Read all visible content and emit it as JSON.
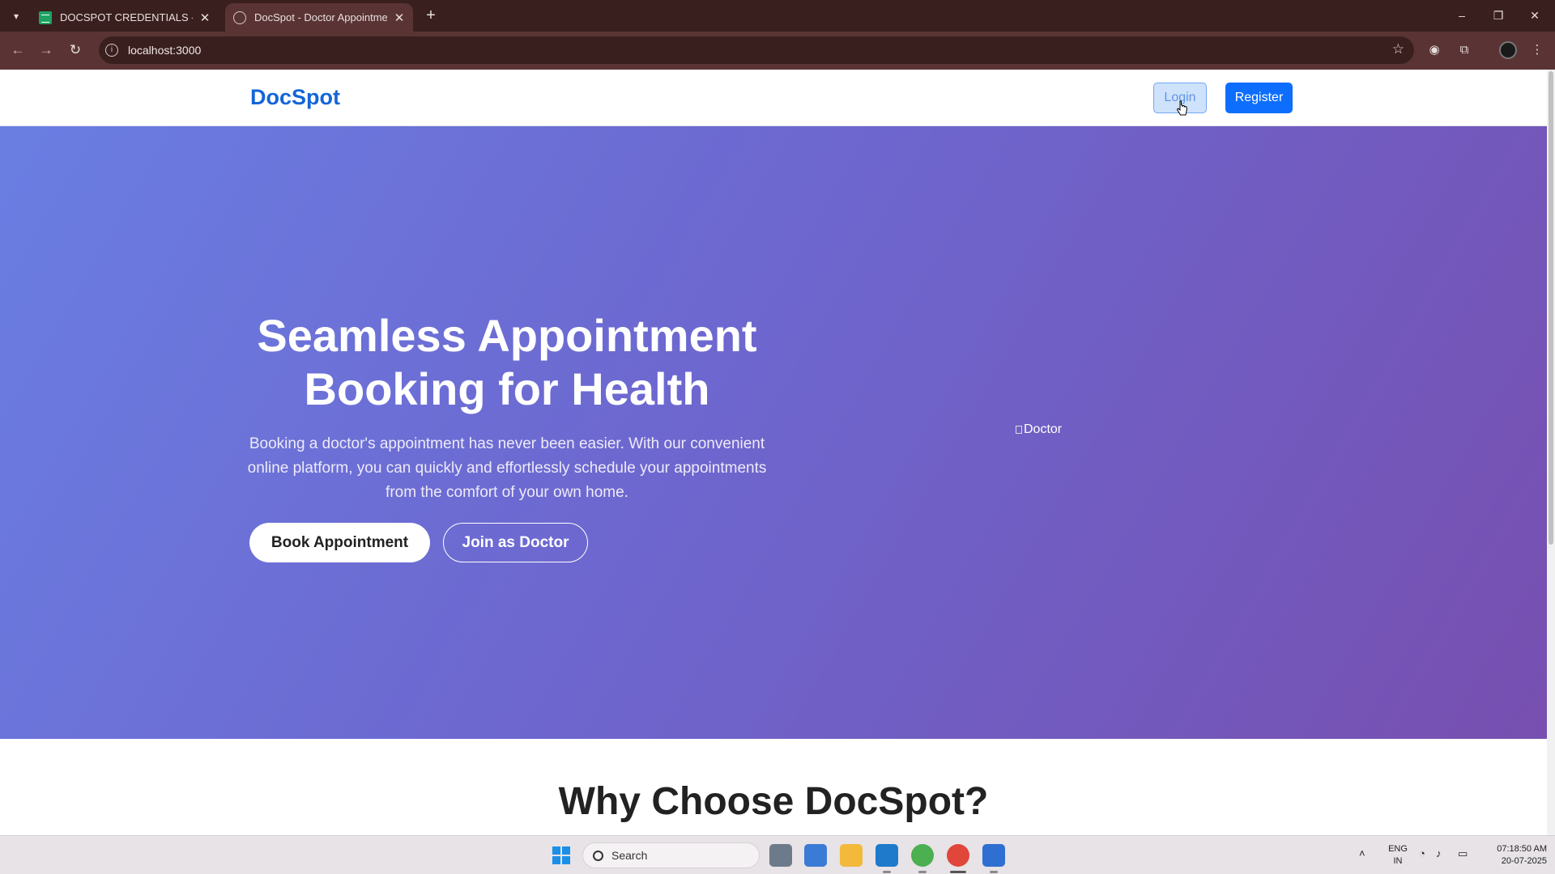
{
  "browser": {
    "tabs": [
      {
        "title": "DOCSPOT CREDENTIALS - Goo",
        "active": false
      },
      {
        "title": "DocSpot - Doctor Appointmen",
        "active": true
      }
    ],
    "url": "localhost:3000"
  },
  "site": {
    "brand": "DocSpot",
    "login_label": "Login",
    "register_label": "Register"
  },
  "hero": {
    "heading": "Seamless Appointment Booking for Health",
    "description": "Booking a doctor's appointment has never been easier. With our convenient online platform, you can quickly and effortlessly schedule your appointments from the comfort of your own home.",
    "book_label": "Book Appointment",
    "join_label": "Join as Doctor",
    "image_alt": "Doctor"
  },
  "section": {
    "why_title": "Why Choose DocSpot?"
  },
  "taskbar": {
    "search_label": "Search",
    "lang_line1": "ENG",
    "lang_line2": "IN",
    "time": "07:18:50 AM",
    "date": "20-07-2025"
  },
  "colors": {
    "brand": "#1565d8",
    "primary_button": "#0d6efd",
    "hero_gradient_start": "#6a7ee2",
    "hero_gradient_end": "#774fb0",
    "browser_frame": "#3a1f1f"
  }
}
